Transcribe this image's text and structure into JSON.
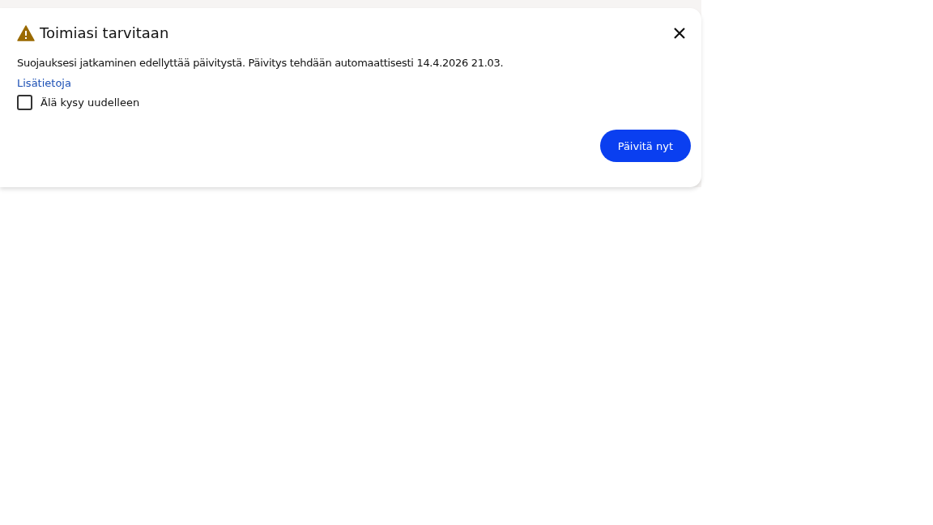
{
  "dialog": {
    "title": "Toimiasi tarvitaan",
    "message": "Suojauksesi jatkaminen edellyttää päivitystä. Päivitys tehdään automaattisesti 14.4.2026 21.03.",
    "link": "Lisätietoja",
    "checkbox": {
      "label": "Älä kysy uudelleen",
      "checked": false
    },
    "button": "Päivitä nyt"
  }
}
